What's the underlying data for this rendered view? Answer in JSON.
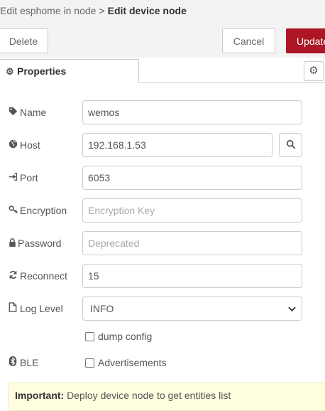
{
  "header": {
    "breadcrumb_parent": "Edit esphome in node",
    "breadcrumb_separator": ">",
    "breadcrumb_current": "Edit device node",
    "delete_label": "Delete",
    "cancel_label": "Cancel",
    "update_label": "Update"
  },
  "tabs": {
    "properties_label": "Properties"
  },
  "form": {
    "name": {
      "label": "Name",
      "value": "wemos",
      "icon": "tag-icon"
    },
    "host": {
      "label": "Host",
      "value": "192.168.1.53",
      "icon": "globe-icon"
    },
    "port": {
      "label": "Port",
      "value": "6053",
      "icon": "sign-in-icon"
    },
    "encryption": {
      "label": "Encryption",
      "value": "",
      "placeholder": "Encryption Key",
      "icon": "key-icon"
    },
    "password": {
      "label": "Password",
      "value": "",
      "placeholder": "Deprecated",
      "icon": "lock-icon"
    },
    "reconnect": {
      "label": "Reconnect",
      "value": "15",
      "icon": "refresh-icon"
    },
    "loglevel": {
      "label": "Log Level",
      "value": "INFO",
      "icon": "file-icon"
    },
    "dump_config": {
      "label": "dump config",
      "checked": false
    },
    "ble": {
      "label": "BLE",
      "option_label": "Advertisements",
      "checked": false,
      "icon": "bluetooth-icon"
    }
  },
  "notice": {
    "strong": "Important:",
    "text": " Deploy device node to get entities list"
  },
  "colors": {
    "update_button": "#ad1625",
    "notice_bg": "#ffffe0"
  }
}
